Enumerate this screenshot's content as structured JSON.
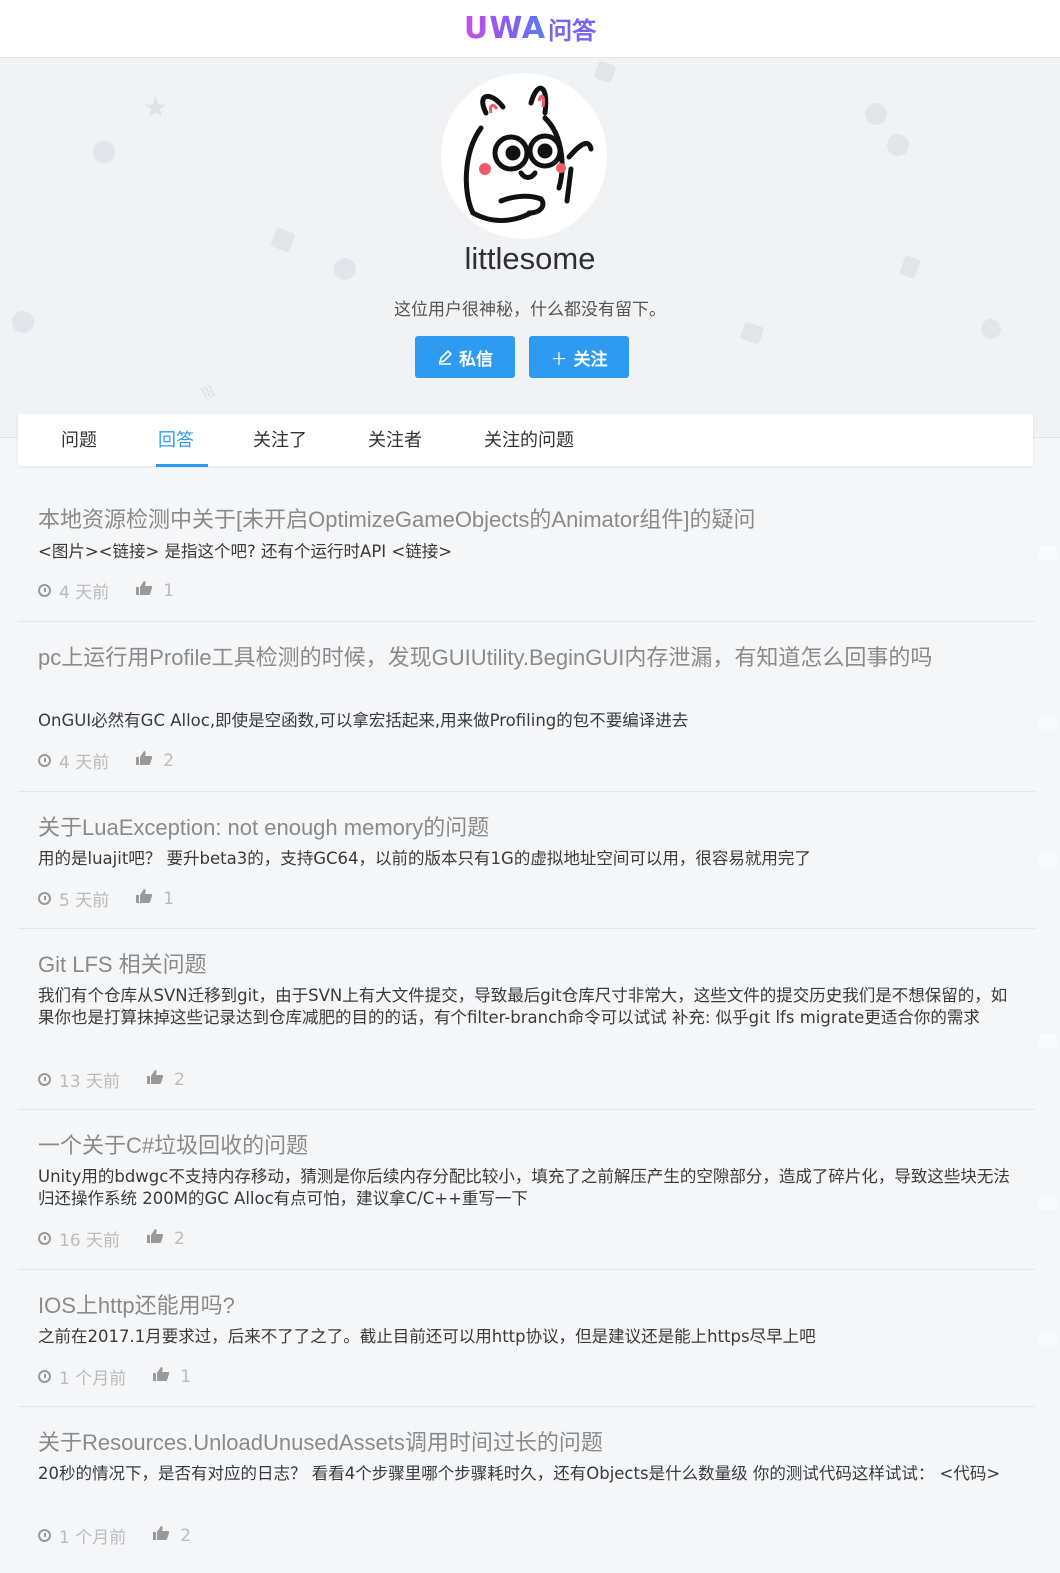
{
  "header": {
    "logo_mark": "UWA",
    "logo_sub": "问答"
  },
  "profile": {
    "username": "littlesome",
    "bio": "这位用户很神秘，什么都没有留下。",
    "message_button": "私信",
    "follow_button": "关注",
    "follow_icon": "＋"
  },
  "tabs": [
    {
      "label": "问题"
    },
    {
      "label": "回答"
    },
    {
      "label": "关注了"
    },
    {
      "label": "关注者"
    },
    {
      "label": "关注的问题"
    }
  ],
  "active_tab": "回答",
  "answers": [
    {
      "title": "本地资源检测中关于[未开启OptimizeGameObjects的Animator组件]的疑问",
      "body": "<图片><链接> 是指这个吧? 还有个运行时API <链接>",
      "time": "4 天前",
      "likes": "1"
    },
    {
      "title": "pc上运行用Profile工具检测的时候，发现GUIUtility.BeginGUI内存泄漏，有知道怎么回事的吗",
      "body": "OnGUI必然有GC Alloc,即使是空函数,可以拿宏括起来,用来做Profiling的包不要编译进去",
      "time": "4 天前",
      "likes": "2"
    },
    {
      "title": "关于LuaException: not enough memory的问题",
      "body": "用的是luajit吧？ 要升beta3的，支持GC64，以前的版本只有1G的虚拟地址空间可以用，很容易就用完了",
      "time": "5 天前",
      "likes": "1"
    },
    {
      "title": "Git LFS 相关问题",
      "body": "我们有个仓库从SVN迁移到git，由于SVN上有大文件提交，导致最后git仓库尺寸非常大，这些文件的提交历史我们是不想保留的，如果你也是打算抹掉这些记录达到仓库减肥的目的的话，有个filter-branch命令可以试试 补充: 似乎git lfs migrate更适合你的需求",
      "time": "13 天前",
      "likes": "2"
    },
    {
      "title": "一个关于C#垃圾回收的问题",
      "body": "Unity用的bdwgc不支持内存移动，猜测是你后续内存分配比较小，填充了之前解压产生的空隙部分，造成了碎片化，导致这些块无法归还操作系统 200M的GC Alloc有点可怕，建议拿C/C++重写一下",
      "time": "16 天前",
      "likes": "2"
    },
    {
      "title": "IOS上http还能用吗?",
      "body": "之前在2017.1月要求过，后来不了了之了。截止目前还可以用http协议，但是建议还是能上https尽早上吧",
      "time": "1 个月前",
      "likes": "1"
    },
    {
      "title": "关于Resources.UnloadUnusedAssets调用时间过长的问题",
      "body": "20秒的情况下，是否有对应的日志？ 看看4个步骤里哪个步骤耗时久，还有Objects是什么数量级 你的测试代码这样试试： <代码>",
      "time": "1 个月前",
      "likes": "2"
    }
  ],
  "colors": {
    "accent": "#2f9bf0",
    "title_gray": "#8a8a8a",
    "meta_gray": "#bbbbbb"
  },
  "icons": [
    "clock-icon",
    "thumbs-up-icon",
    "pen-icon",
    "plus-icon",
    "rabbit-avatar"
  ]
}
